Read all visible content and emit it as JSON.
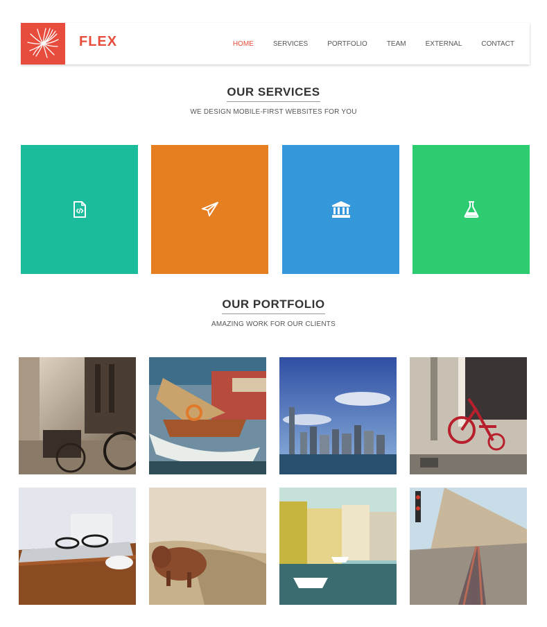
{
  "header": {
    "brand": "FLEX",
    "logo_icon": "starburst-logo-icon",
    "nav": [
      "HOME",
      "SERVICES",
      "PORTFOLIO",
      "TEAM",
      "EXTERNAL",
      "CONTACT"
    ],
    "active_nav": "HOME"
  },
  "services": {
    "title": "OUR SERVICES",
    "subtitle": "WE DESIGN MOBILE-FIRST WEBSITES FOR YOU",
    "tiles": [
      {
        "icon": "code-file-icon",
        "color": "#1abc9c"
      },
      {
        "icon": "paper-plane-icon",
        "color": "#e67e22"
      },
      {
        "icon": "bank-icon",
        "color": "#3498db"
      },
      {
        "icon": "flask-icon",
        "color": "#2ecc71"
      }
    ]
  },
  "portfolio": {
    "title": "OUR PORTFOLIO",
    "subtitle": "AMAZING WORK FOR OUR CLIENTS",
    "items": [
      {
        "subject": "city-street-bicycles"
      },
      {
        "subject": "sailboat-harbor"
      },
      {
        "subject": "city-skyline"
      },
      {
        "subject": "red-tricycle"
      },
      {
        "subject": "laptop-glasses-desk"
      },
      {
        "subject": "highland-cow"
      },
      {
        "subject": "canal-houses"
      },
      {
        "subject": "railway-tracks-coast"
      }
    ]
  },
  "colors": {
    "accent": "#e74c3c"
  }
}
